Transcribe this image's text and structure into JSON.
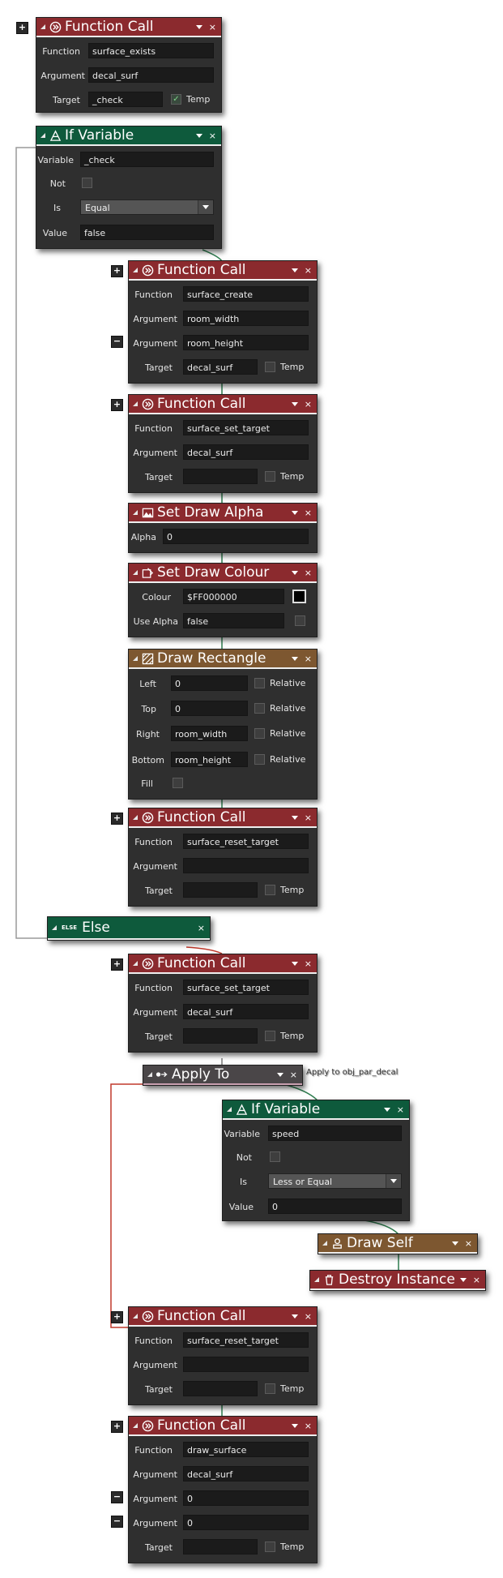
{
  "icons": {
    "add": "+",
    "remove": "−",
    "dropdown": "dropdown-icon",
    "close": "×",
    "check": "✓"
  },
  "b1": {
    "title": "Function Call",
    "function": "Function",
    "function_val": "surface_exists",
    "argument": "Argument",
    "argument_val": "decal_surf",
    "target": "Target",
    "target_val": "_check",
    "temp": "Temp"
  },
  "b2": {
    "title": "If Variable",
    "variable": "Variable",
    "variable_val": "_check",
    "not": "Not",
    "is": "Is",
    "is_val": "Equal",
    "value": "Value",
    "value_val": "false"
  },
  "b3": {
    "title": "Function Call",
    "function": "Function",
    "function_val": "surface_create",
    "argument": "Argument",
    "arg1_val": "room_width",
    "arg2_val": "room_height",
    "target": "Target",
    "target_val": "decal_surf",
    "temp": "Temp"
  },
  "b4": {
    "title": "Function Call",
    "function": "Function",
    "function_val": "surface_set_target",
    "argument": "Argument",
    "argument_val": "decal_surf",
    "target": "Target",
    "target_val": "",
    "temp": "Temp"
  },
  "b5": {
    "title": "Set Draw Alpha",
    "alpha": "Alpha",
    "alpha_val": "0"
  },
  "b6": {
    "title": "Set Draw Colour",
    "colour": "Colour",
    "colour_val": "$FF000000",
    "use_alpha": "Use Alpha",
    "use_alpha_val": "false",
    "swatch_color": "#000000"
  },
  "b7": {
    "title": "Draw Rectangle",
    "left": "Left",
    "left_val": "0",
    "top": "Top",
    "top_val": "0",
    "right": "Right",
    "right_val": "room_width",
    "bottom": "Bottom",
    "bottom_val": "room_height",
    "fill": "Fill",
    "relative": "Relative"
  },
  "b8": {
    "title": "Function Call",
    "function": "Function",
    "function_val": "surface_reset_target",
    "argument": "Argument",
    "argument_val": "",
    "target": "Target",
    "target_val": "",
    "temp": "Temp"
  },
  "b9": {
    "badge": "ELSE",
    "title": "Else"
  },
  "b10": {
    "title": "Function Call",
    "function": "Function",
    "function_val": "surface_set_target",
    "argument": "Argument",
    "argument_val": "decal_surf",
    "target": "Target",
    "target_val": "",
    "temp": "Temp"
  },
  "b11": {
    "title": "Apply To",
    "note": "Apply to obj_par_decal"
  },
  "b12": {
    "title": "If Variable",
    "variable": "Variable",
    "variable_val": "speed",
    "not": "Not",
    "is": "Is",
    "is_val": "Less or Equal",
    "value": "Value",
    "value_val": "0"
  },
  "b13": {
    "title": "Draw Self"
  },
  "b14": {
    "title": "Destroy Instance"
  },
  "b15": {
    "title": "Function Call",
    "function": "Function",
    "function_val": "surface_reset_target",
    "argument": "Argument",
    "argument_val": "",
    "target": "Target",
    "target_val": "",
    "temp": "Temp"
  },
  "b16": {
    "title": "Function Call",
    "function": "Function",
    "function_val": "draw_surface",
    "argument": "Argument",
    "arg1_val": "decal_surf",
    "arg2_val": "0",
    "arg3_val": "0",
    "target": "Target",
    "target_val": "",
    "temp": "Temp"
  },
  "colors": {
    "function_call": "#8b2a2e",
    "if_variable": "#0e5a3c",
    "draw_action": "#7d5730",
    "apply_to": "#4a4648",
    "connector_green": "#2e7d4f",
    "connector_red": "#c0392b"
  }
}
